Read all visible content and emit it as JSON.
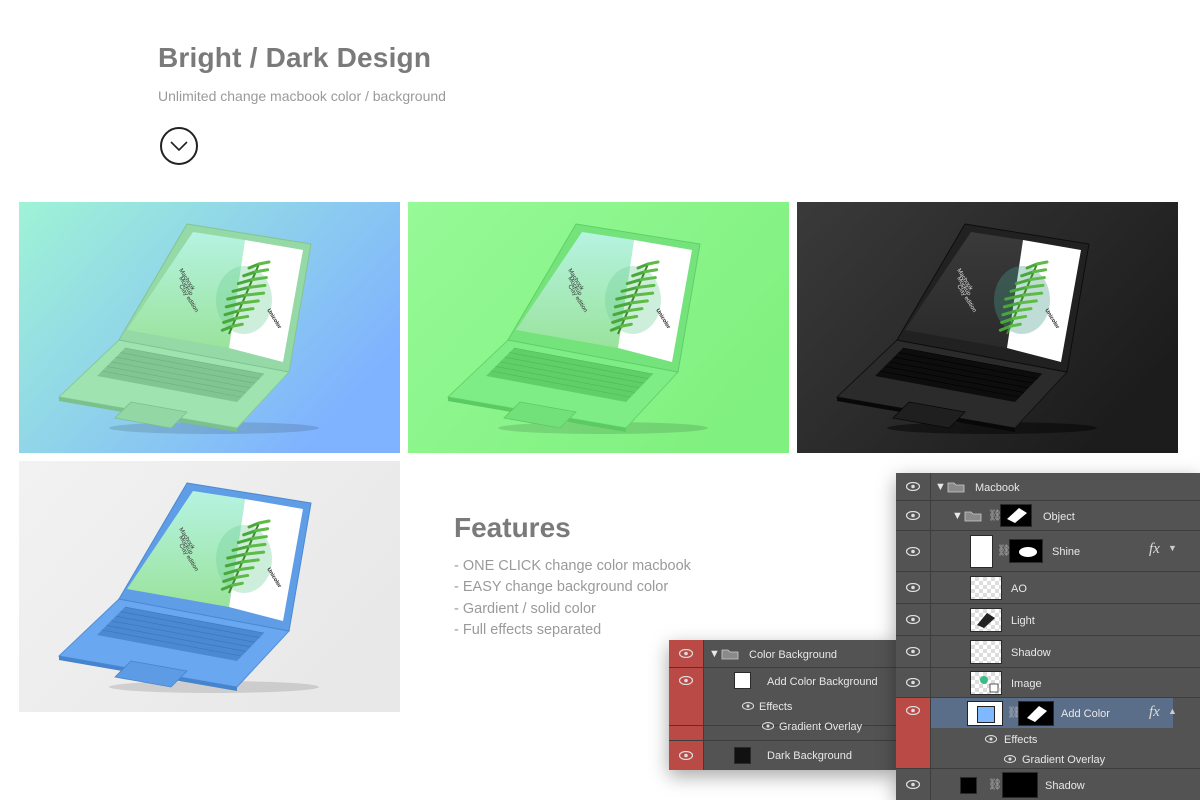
{
  "header": {
    "title": "Bright / Dark Design",
    "subtitle": "Unlimited change macbook color /  background"
  },
  "mockups": [
    {
      "name": "Gradient teal-blue",
      "bg_from": "#9ff3d6",
      "bg_to": "#7fb2ff",
      "body": "#9fe3b0"
    },
    {
      "name": "Solid green",
      "bg_from": "#96fa96",
      "bg_to": "#80f080",
      "body": "#7eed86"
    },
    {
      "name": "Dark",
      "bg_from": "#3a3a3a",
      "bg_to": "#1c1c1c",
      "body": "#2b2b2b"
    },
    {
      "name": "Light grey / blue",
      "bg_from": "#f2f2f2",
      "bg_to": "#e8e8e8",
      "body": "#69a7f0"
    }
  ],
  "screen": {
    "line1": "Macbook",
    "line2": "Mockup",
    "line3": "Clay edition",
    "brand": "Unicolor"
  },
  "features": {
    "title": "Features",
    "items": [
      "- ONE CLICK change color macbook",
      "- EASY change background color",
      "- Gardient / solid color",
      "- Full effects separated"
    ]
  },
  "panel_left": {
    "rows": [
      {
        "label": "Color Background",
        "type": "group"
      },
      {
        "label": "Add Color Background",
        "type": "layer"
      },
      {
        "label": "Effects",
        "type": "effects"
      },
      {
        "label": "Gradient Overlay",
        "type": "effect"
      },
      {
        "label": "Dark Background",
        "type": "layer"
      }
    ]
  },
  "panel_right": {
    "rows": [
      {
        "label": "Macbook"
      },
      {
        "label": "Object"
      },
      {
        "label": "Shine"
      },
      {
        "label": "AO"
      },
      {
        "label": "Light"
      },
      {
        "label": "Shadow"
      },
      {
        "label": "Image"
      },
      {
        "label": "Add Color"
      },
      {
        "label": "Effects"
      },
      {
        "label": "Gradient Overlay"
      },
      {
        "label": "Shadow"
      }
    ],
    "fx_label": "fx"
  },
  "colors": {
    "layer_red": "#b94a45",
    "panel_bg": "#535353",
    "selected_row": "#5a6e8a",
    "add_color_swatch": "#7fb8ff"
  }
}
